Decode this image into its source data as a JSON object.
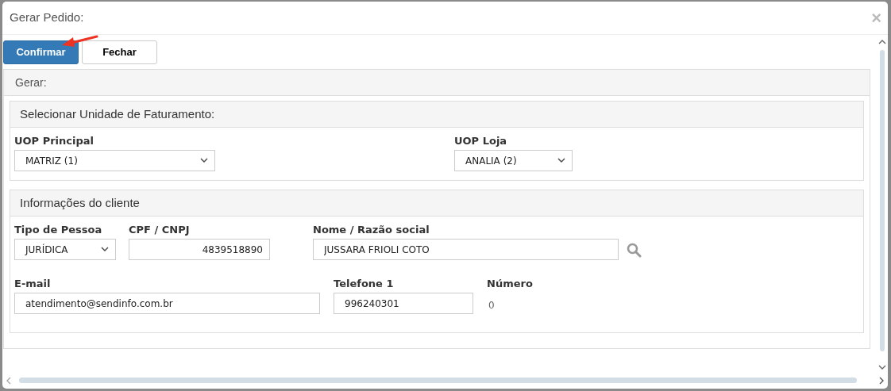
{
  "dialog": {
    "title": "Gerar Pedido:",
    "close": "×"
  },
  "buttons": [
    {
      "label": "Confirmar",
      "kind": "primary"
    },
    {
      "label": "Fechar",
      "kind": "default"
    }
  ],
  "panel": {
    "title": "Gerar:",
    "sections": [
      {
        "title": "Selecionar Unidade de Faturamento:",
        "lines": [
          {
            "fields": [
              {
                "label": "UOP Principal",
                "kind": "select",
                "value": "MATRIZ (1)"
              },
              {
                "label": "UOP Loja",
                "kind": "select",
                "value": "ANALIA (2)"
              }
            ]
          }
        ]
      },
      {
        "title": "Informações do cliente",
        "lines": [
          {
            "fields": [
              {
                "label": "Tipo de Pessoa",
                "kind": "select",
                "value": "JURÍDICA"
              },
              {
                "label": "CPF / CNPJ",
                "kind": "numeric",
                "value": "4839518890"
              },
              {
                "label": "Nome / Razão social",
                "kind": "search",
                "value": "JUSSARA FRIOLI COTO"
              }
            ]
          },
          {
            "fields": [
              {
                "label": "E-mail",
                "kind": "input",
                "value": "atendimento@sendinfo.com.br"
              },
              {
                "label": "Telefone 1",
                "kind": "input",
                "value": "996240301"
              },
              {
                "label": "Número",
                "kind": "static",
                "value": "0"
              }
            ]
          }
        ]
      }
    ]
  }
}
